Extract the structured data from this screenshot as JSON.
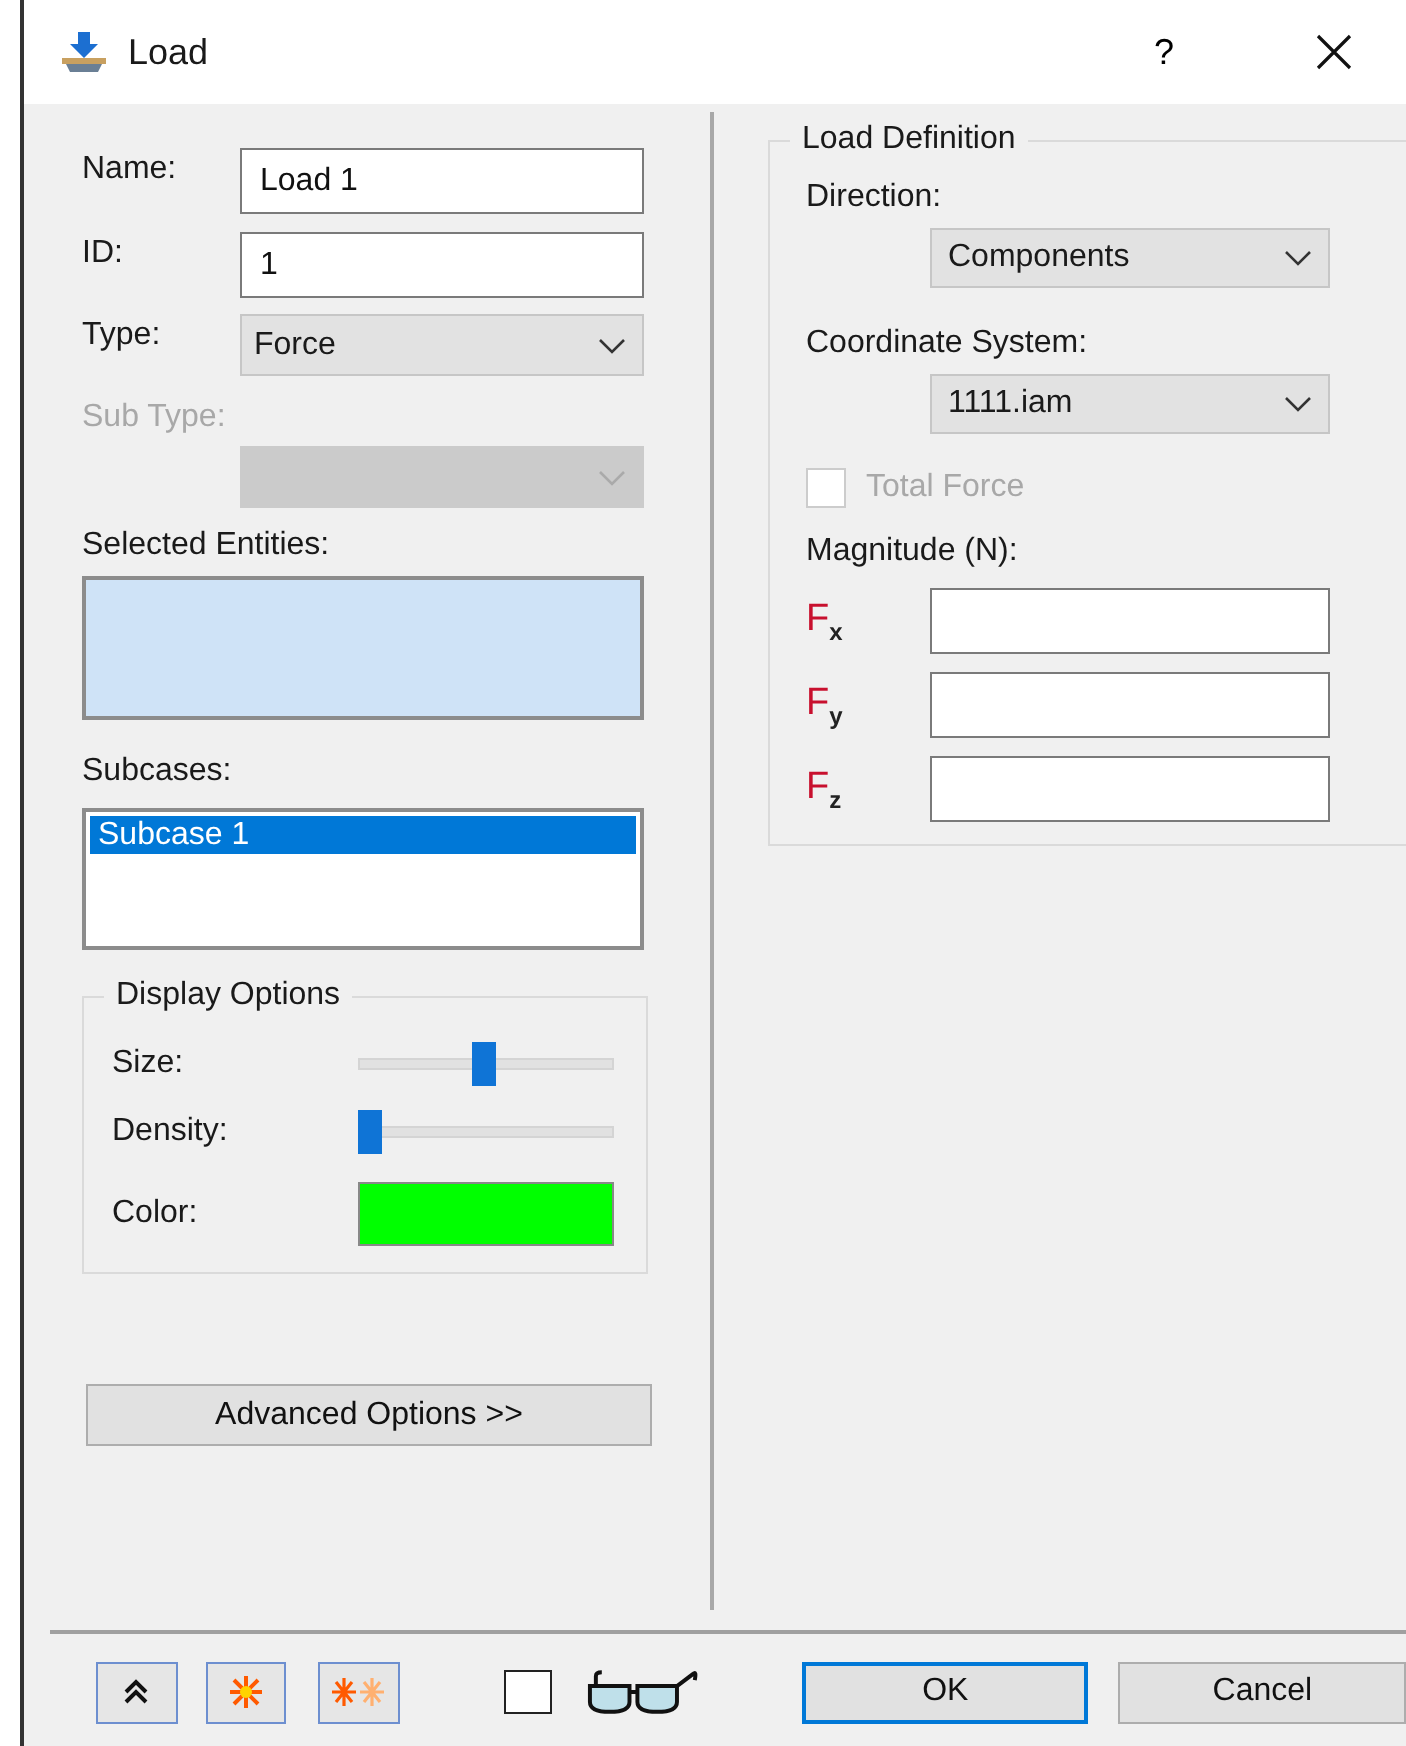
{
  "window": {
    "title": "Load",
    "help": "?"
  },
  "general": {
    "name": {
      "label": "Name:",
      "value": "Load 1"
    },
    "id": {
      "label": "ID:",
      "value": "1"
    },
    "type": {
      "label": "Type:",
      "value": "Force"
    },
    "sub_type": {
      "label": "Sub Type:",
      "disabled": true
    },
    "selected_entities": {
      "label": "Selected Entities:"
    },
    "subcases": {
      "label": "Subcases:",
      "items": [
        {
          "label": "Subcase 1",
          "selected": true
        }
      ]
    }
  },
  "display_options": {
    "title": "Display Options",
    "size": {
      "label": "Size:",
      "level": 0.5
    },
    "density": {
      "label": "Density:",
      "level": 0
    },
    "color": {
      "label": "Color:",
      "color": "#00ff00"
    }
  },
  "advanced_button": "Advanced Options >>",
  "load_definition": {
    "title": "Load Definition",
    "direction": {
      "label": "Direction:",
      "value": "Components"
    },
    "coordinate_system": {
      "label": "Coordinate System:",
      "value": "1111.iam"
    },
    "total_force": {
      "label": "Total Force",
      "checked": false,
      "disabled": true
    },
    "magnitude": {
      "label": "Magnitude (N):",
      "components": [
        {
          "label": "F$_{x}$"
        },
        {
          "label": "F$_{y}$"
        },
        {
          "label": "F$_{z}$"
        }
      ]
    }
  },
  "footer": {
    "show_checkbox": {
      "checked": false
    },
    "ok": "OK",
    "cancel": "Cancel"
  }
}
